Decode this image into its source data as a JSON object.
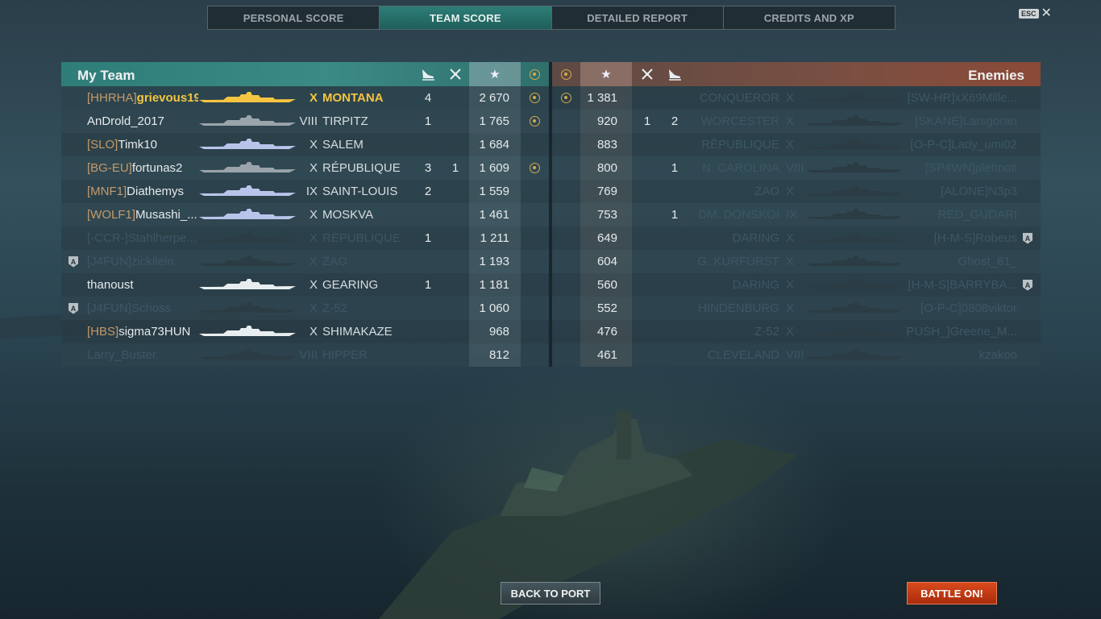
{
  "tabs": [
    {
      "label": "PERSONAL SCORE"
    },
    {
      "label": "TEAM SCORE"
    },
    {
      "label": "DETAILED REPORT"
    },
    {
      "label": "CREDITS AND XP"
    }
  ],
  "active_tab": 1,
  "esc_label": "ESC",
  "my_team": {
    "title": "My Team",
    "rows": [
      {
        "clan": "[HHRHA]",
        "name": "grievous19...",
        "tier": "X",
        "ship": "MONTANA",
        "planes": "4",
        "ships": "",
        "score": "2 670",
        "medal": true,
        "state": "mine",
        "silh": "#f5c542",
        "auto": false
      },
      {
        "clan": "",
        "name": "AnDrold_2017",
        "tier": "VIII",
        "ship": "TIRPITZ",
        "planes": "1",
        "ships": "",
        "score": "1 765",
        "medal": true,
        "state": "alive",
        "silh": "#9aa4aa",
        "auto": false
      },
      {
        "clan": "[SLO]",
        "name": "Timk10",
        "tier": "X",
        "ship": "SALEM",
        "planes": "",
        "ships": "",
        "score": "1 684",
        "medal": false,
        "state": "alive",
        "silh": "#b9c4ea",
        "auto": false
      },
      {
        "clan": "[BG-EU]",
        "name": "fortunas2",
        "tier": "X",
        "ship": "RÉPUBLIQUE",
        "planes": "3",
        "ships": "1",
        "score": "1 609",
        "medal": true,
        "state": "alive",
        "silh": "#9aa4aa",
        "auto": false
      },
      {
        "clan": "[MNF1]",
        "name": "Diathemys",
        "tier": "IX",
        "ship": "SAINT-LOUIS",
        "planes": "2",
        "ships": "",
        "score": "1 559",
        "medal": false,
        "state": "alive",
        "silh": "#b9c4ea",
        "auto": false
      },
      {
        "clan": "[WOLF1]",
        "name": "Musashi_...",
        "tier": "X",
        "ship": "MOSKVA",
        "planes": "",
        "ships": "",
        "score": "1 461",
        "medal": false,
        "state": "alive",
        "silh": "#b9c4ea",
        "auto": false
      },
      {
        "clan": "[-CCR-]",
        "name": "Stahlherpe...",
        "tier": "X",
        "ship": "RÉPUBLIQUE",
        "planes": "1",
        "ships": "",
        "score": "1 211",
        "medal": false,
        "state": "dead",
        "silh": "#2c3c44",
        "auto": false
      },
      {
        "clan": "[J4FUN]",
        "name": "zickilein",
        "tier": "X",
        "ship": "ZAO",
        "planes": "",
        "ships": "",
        "score": "1 193",
        "medal": false,
        "state": "dead",
        "silh": "#2c3c44",
        "auto": true
      },
      {
        "clan": "",
        "name": "thanoust",
        "tier": "X",
        "ship": "GEARING",
        "planes": "1",
        "ships": "",
        "score": "1 181",
        "medal": false,
        "state": "alive",
        "silh": "#e8eef0",
        "auto": false
      },
      {
        "clan": "[J4FUN]",
        "name": "Schoss",
        "tier": "X",
        "ship": "Z-52",
        "planes": "",
        "ships": "",
        "score": "1 060",
        "medal": false,
        "state": "dead",
        "silh": "#2c3c44",
        "auto": true
      },
      {
        "clan": "[HBS]",
        "name": "sigma73HUN",
        "tier": "X",
        "ship": "SHIMAKAZE",
        "planes": "",
        "ships": "",
        "score": "968",
        "medal": false,
        "state": "alive",
        "silh": "#e8eef0",
        "auto": false
      },
      {
        "clan": "",
        "name": "Larry_Buster",
        "tier": "VIII",
        "ship": "HIPPER",
        "planes": "",
        "ships": "",
        "score": "812",
        "medal": false,
        "state": "dead",
        "silh": "#2c3c44",
        "auto": false
      }
    ]
  },
  "enemies": {
    "title": "Enemies",
    "rows": [
      {
        "medal": true,
        "score": "1 381",
        "ships": "",
        "planes": "",
        "ship": "CONQUEROR",
        "tier": "X",
        "clan": "[SW-HR]",
        "name": "xX69Mille...",
        "auto": false
      },
      {
        "medal": false,
        "score": "920",
        "ships": "1",
        "planes": "2",
        "ship": "WORCESTER",
        "tier": "X",
        "clan": "[SKANE]",
        "name": "Larsgoran",
        "auto": false
      },
      {
        "medal": false,
        "score": "883",
        "ships": "",
        "planes": "",
        "ship": "RÉPUBLIQUE",
        "tier": "X",
        "clan": "[O-P-C]",
        "name": "Lady_umi02",
        "auto": false
      },
      {
        "medal": false,
        "score": "800",
        "ships": "",
        "planes": "1",
        "ship": "N. CAROLINA",
        "tier": "VIII",
        "clan": "[SP4WN]",
        "name": "plehnoti",
        "auto": false
      },
      {
        "medal": false,
        "score": "769",
        "ships": "",
        "planes": "",
        "ship": "ZAO",
        "tier": "X",
        "clan": "[ALONE]",
        "name": "N3p3",
        "auto": false
      },
      {
        "medal": false,
        "score": "753",
        "ships": "",
        "planes": "1",
        "ship": "DM. DONSKOI",
        "tier": "IX",
        "clan": "",
        "name": "RED_GUDARI",
        "auto": false
      },
      {
        "medal": false,
        "score": "649",
        "ships": "",
        "planes": "",
        "ship": "DARING",
        "tier": "X",
        "clan": "[H-M-S]",
        "name": "Robeus",
        "auto": true
      },
      {
        "medal": false,
        "score": "604",
        "ships": "",
        "planes": "",
        "ship": "G. KURFÜRST",
        "tier": "X",
        "clan": "",
        "name": "Ghost_81_",
        "auto": false
      },
      {
        "medal": false,
        "score": "560",
        "ships": "",
        "planes": "",
        "ship": "DARING",
        "tier": "X",
        "clan": "[H-M-S]",
        "name": "BARRYBA...",
        "auto": true
      },
      {
        "medal": false,
        "score": "552",
        "ships": "",
        "planes": "",
        "ship": "HINDENBURG",
        "tier": "X",
        "clan": "[O-P-C]",
        "name": "0808viktor",
        "auto": false
      },
      {
        "medal": false,
        "score": "476",
        "ships": "",
        "planes": "",
        "ship": "Z-52",
        "tier": "X",
        "clan": "[PUSH_]",
        "name": "Greene_M...",
        "auto": false
      },
      {
        "medal": false,
        "score": "461",
        "ships": "",
        "planes": "",
        "ship": "CLEVELAND",
        "tier": "VIII",
        "clan": "",
        "name": "kzakoo",
        "auto": false
      }
    ]
  },
  "header_icons": {
    "planes": "plane-destroyed-icon",
    "ships": "ship-destroyed-icon",
    "score": "★",
    "medal": "medal-icon"
  },
  "buttons": {
    "back": "BACK TO PORT",
    "battle": "BATTLE ON!"
  },
  "colors": {
    "my_team_header": "#2f7d79",
    "enemy_header": "#7a4f42",
    "player_highlight": "#f5c542",
    "clan_tag": "#c59a6a",
    "battle_button": "#c7381a"
  }
}
